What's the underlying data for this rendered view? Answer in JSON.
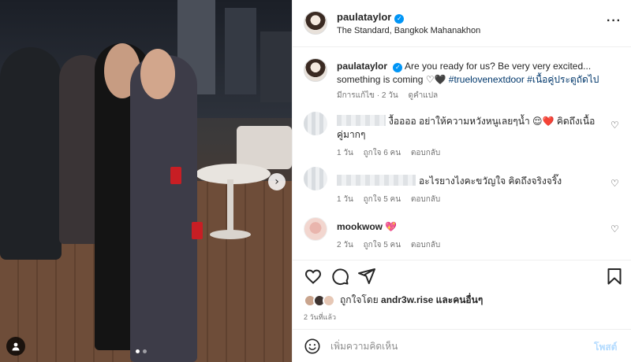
{
  "post": {
    "username": "paulataylor",
    "location": "The Standard, Bangkok Mahanakhon",
    "more_label": "···",
    "caption": {
      "username": "paulataylor",
      "text": "Are you ready for us? Be very very excited... something is coming",
      "hearts": "♡🖤",
      "hashtag1": "#trueloveneхtdoor",
      "hashtag2": "#เนื้อคู่ประตูถัดไป",
      "edited": "มีการแก้ไข · 2 วัน",
      "translate": "ดูคำแปล"
    },
    "comments": [
      {
        "text": "งื้ออออ อย่าให้ความหวังหนูเลยๆน้ำ",
        "emoji": "😌❤️",
        "text2": "คิดถึงเนื้อคู่มากๆ",
        "time": "1 วัน",
        "likes": "ถูกใจ 6 คน",
        "reply": "ตอบกลับ"
      },
      {
        "text": "อะไรยางไงคะขวัญใจ คิดถึงจริงจริ๊ง",
        "time": "1 วัน",
        "likes": "ถูกใจ 5 คน",
        "reply": "ตอบกลับ"
      },
      {
        "username": "mookwow",
        "emoji": "💖",
        "time": "2 วัน",
        "likes": "ถูกใจ 5 คน",
        "reply": "ตอบกลับ"
      }
    ],
    "liked_by": {
      "prefix": "ถูกใจโดย",
      "user": "andr3w.rise",
      "and": "และ",
      "others": "คนอื่นๆ"
    },
    "time_ago": "2 วันที่แล้ว",
    "add_comment": {
      "placeholder": "เพิ่มความคิดเห็น",
      "post_label": "โพสต์"
    },
    "next_arrow": "›"
  },
  "icons": [
    "heart-icon",
    "comment-icon",
    "share-icon",
    "bookmark-icon",
    "emoji-icon",
    "tag-user-icon",
    "more-icon",
    "next-arrow-icon"
  ]
}
